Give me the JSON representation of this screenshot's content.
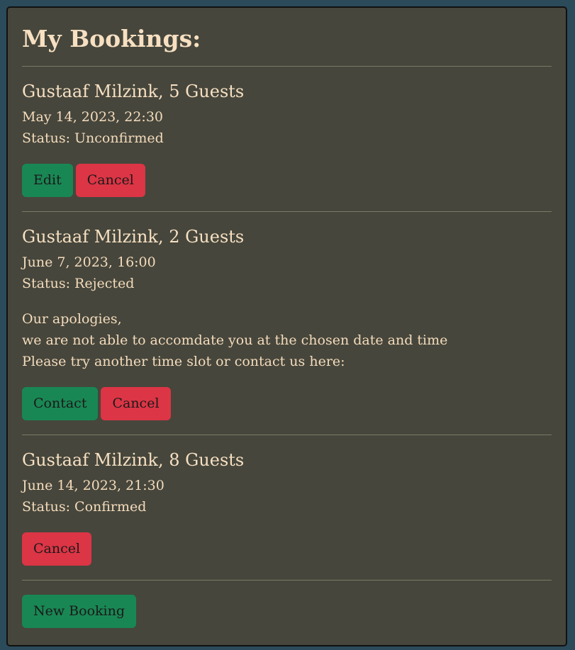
{
  "page": {
    "title": "My Bookings:"
  },
  "bookings": [
    {
      "heading": "Gustaaf Milzink, 5 Guests",
      "datetime": "May 14, 2023, 22:30",
      "status": "Status: Unconfirmed",
      "buttons": [
        "Edit",
        "Cancel"
      ]
    },
    {
      "heading": "Gustaaf Milzink, 2 Guests",
      "datetime": "June 7, 2023, 16:00",
      "status": "Status: Rejected",
      "message": [
        "Our apologies,",
        "we are not able to accomdate you at the chosen date and time",
        "Please try another time slot or contact us here:"
      ],
      "buttons": [
        "Contact",
        "Cancel"
      ]
    },
    {
      "heading": "Gustaaf Milzink, 8 Guests",
      "datetime": "June 14, 2023, 21:30",
      "status": "Status: Confirmed",
      "buttons": [
        "Cancel"
      ]
    }
  ],
  "actions": {
    "new_booking_label": "New Booking"
  },
  "colors": {
    "background": "#2b4a5a",
    "panel": "#46463c",
    "text": "#f5dcbc",
    "green_button": "#198754",
    "red_button": "#dc3545"
  }
}
